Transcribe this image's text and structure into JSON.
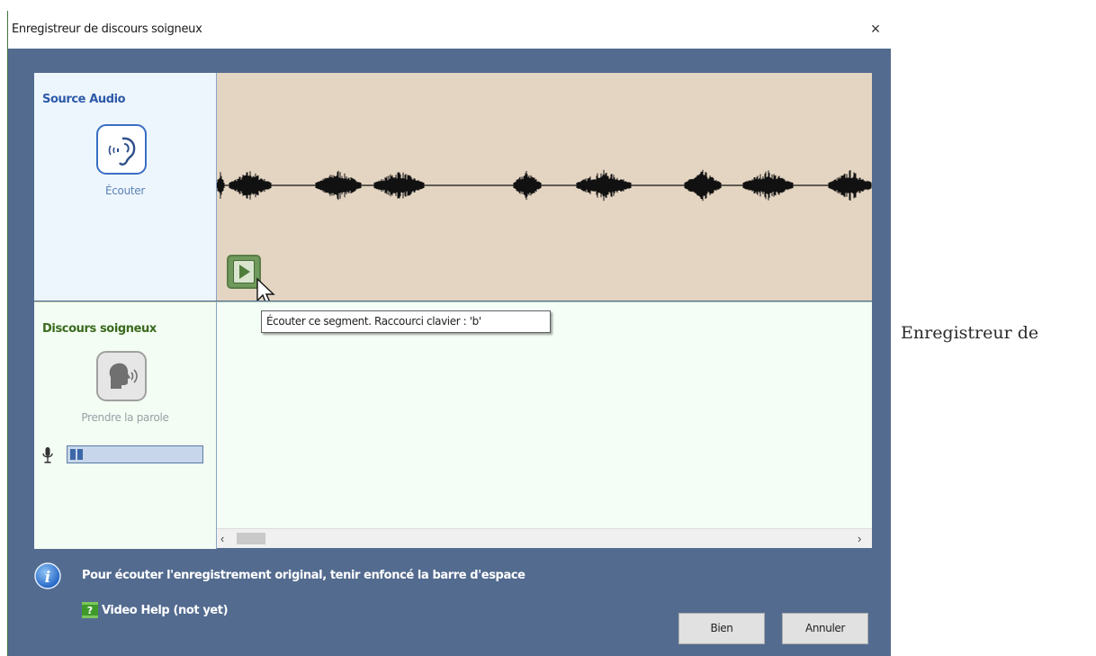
{
  "window": {
    "title": "Enregistreur de discours soigneux",
    "close_label": "×"
  },
  "source": {
    "label": "Source Audio",
    "listen_label": "Écouter"
  },
  "discourse": {
    "label": "Discours soigneux",
    "speak_label": "Prendre la parole",
    "mic_level": 0.12
  },
  "tooltip": "Écouter ce segment. Raccourci clavier : 'b'",
  "scrollbar": {
    "left": "‹",
    "right": "›"
  },
  "info": {
    "text": "Pour écouter l'enregistrement original, tenir enfoncé la barre d'espace"
  },
  "video_help": {
    "icon_label": "?",
    "label": "Video Help (not yet)"
  },
  "buttons": {
    "ok": "Bien",
    "cancel": "Annuler"
  },
  "side_text": "Enregistreur de",
  "colors": {
    "dialog_bg": "#536b8f",
    "waveform_bg": "#e4d5c2",
    "source_label": "#2d5aa8",
    "discourse_label": "#3b6a1e",
    "play_button": "#6f9a5c"
  }
}
